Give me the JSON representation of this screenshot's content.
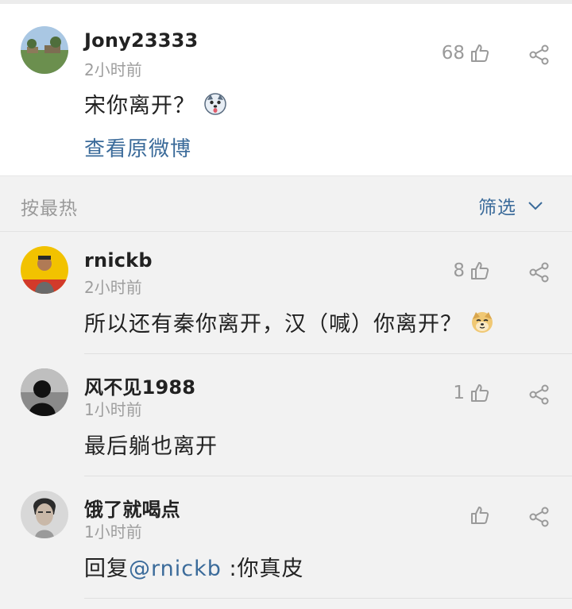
{
  "main_comment": {
    "username": "Jony23333",
    "time": "2小时前",
    "content": "宋你离开？",
    "emoji_icon": "husky-emoji-icon",
    "likes": "68",
    "view_original": "查看原微博"
  },
  "sort_bar": {
    "label": "按最热",
    "filter_label": "筛选"
  },
  "replies": [
    {
      "username": "rnickb",
      "time": "2小时前",
      "content": "所以还有秦你离开，汉（喊）你离开？",
      "emoji_icon": "doge-emoji-icon",
      "likes": "8"
    },
    {
      "username": "风不见1988",
      "time": "1小时前",
      "content": "最后躺也离开",
      "likes": "1"
    },
    {
      "username": "饿了就喝点",
      "time": "1小时前",
      "content_prefix": "回复",
      "mention": "@rnickb",
      "content_suffix": " :你真皮",
      "likes": ""
    }
  ],
  "colors": {
    "link": "#3b6b9a",
    "secondary_text": "#9a9a9a",
    "background": "#f2f2f2",
    "card": "#ffffff"
  }
}
